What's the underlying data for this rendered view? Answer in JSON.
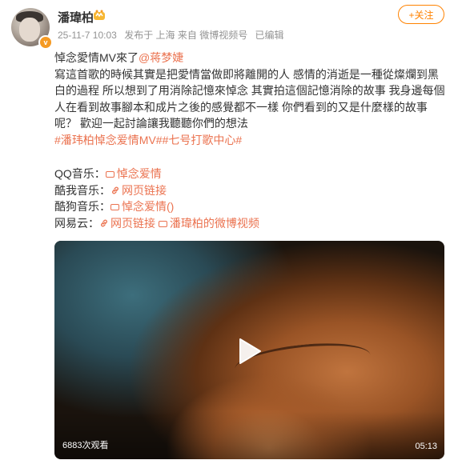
{
  "post": {
    "author": {
      "name": "潘瑋柏"
    },
    "meta": {
      "time": "25-11-7 10:03",
      "source": "发布于 上海 来自 微博视频号",
      "edited": "已编辑"
    },
    "follow_label": "+关注",
    "text": {
      "line1_prefix": "悼念愛情MV來了",
      "mention": "@蒋梦婕",
      "body": "寫這首歌的時候其實是把愛情當做即將離開的人 感情的消逝是一種從燦爛到黑白的過程 所以想到了用消除記憶來悼念 其實拍這個記憶消除的故事 我身邊每個人在看到故事腳本和成片之後的感覺都不一樣 你們看到的又是什麼樣的故事呢？ 歡迎一起討論讓我聽聽你們的想法",
      "hashtags": "#潘玮柏悼念爱情MV##七号打歌中心#"
    },
    "music_links": [
      {
        "platform": "QQ音乐：",
        "items": [
          {
            "type": "video",
            "label": "悼念爱情"
          }
        ]
      },
      {
        "platform": "酷我音乐：",
        "items": [
          {
            "type": "link",
            "label": "网页链接"
          }
        ]
      },
      {
        "platform": "酷狗音乐：",
        "items": [
          {
            "type": "video",
            "label": "悼念爱情()"
          }
        ]
      },
      {
        "platform": "网易云：",
        "items": [
          {
            "type": "link",
            "label": "网页链接"
          },
          {
            "type": "video",
            "label": "潘瑋柏的微博视频"
          }
        ]
      }
    ],
    "video": {
      "views": "6883次观看",
      "duration": "05:13"
    }
  },
  "colors": {
    "accent": "#ff8200",
    "link": "#eb7350",
    "meta": "#939393",
    "badge": "#f59a23"
  }
}
